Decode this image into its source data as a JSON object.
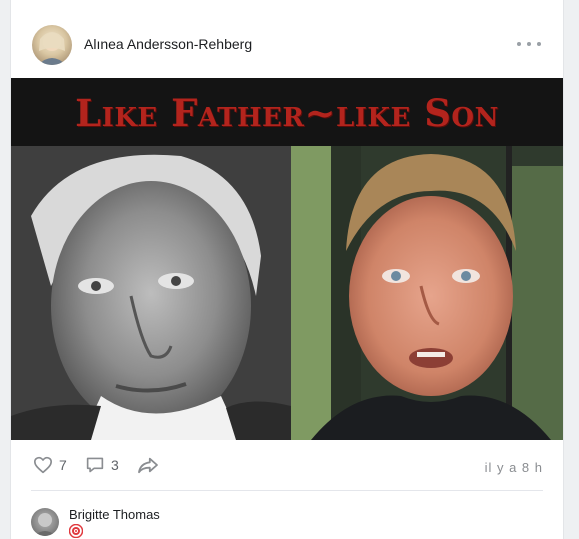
{
  "post": {
    "author": "Alınea Andersson-Rehberg",
    "image_headline": "Like Father~like Son",
    "timestamp": "il y a 8 h",
    "actions": {
      "like_count": "7",
      "comment_count": "3"
    }
  },
  "comment": {
    "author": "Brigitte Thomas"
  },
  "icons": {
    "more": "ellipsis-icon",
    "like": "heart-icon",
    "comment": "comment-bubble-icon",
    "share": "share-arrow-icon",
    "emoji": "target-emoji-icon"
  },
  "colors": {
    "headline_red": "#b3241d",
    "muted_text": "#5f6368",
    "icon_gray": "#8a8d91"
  }
}
